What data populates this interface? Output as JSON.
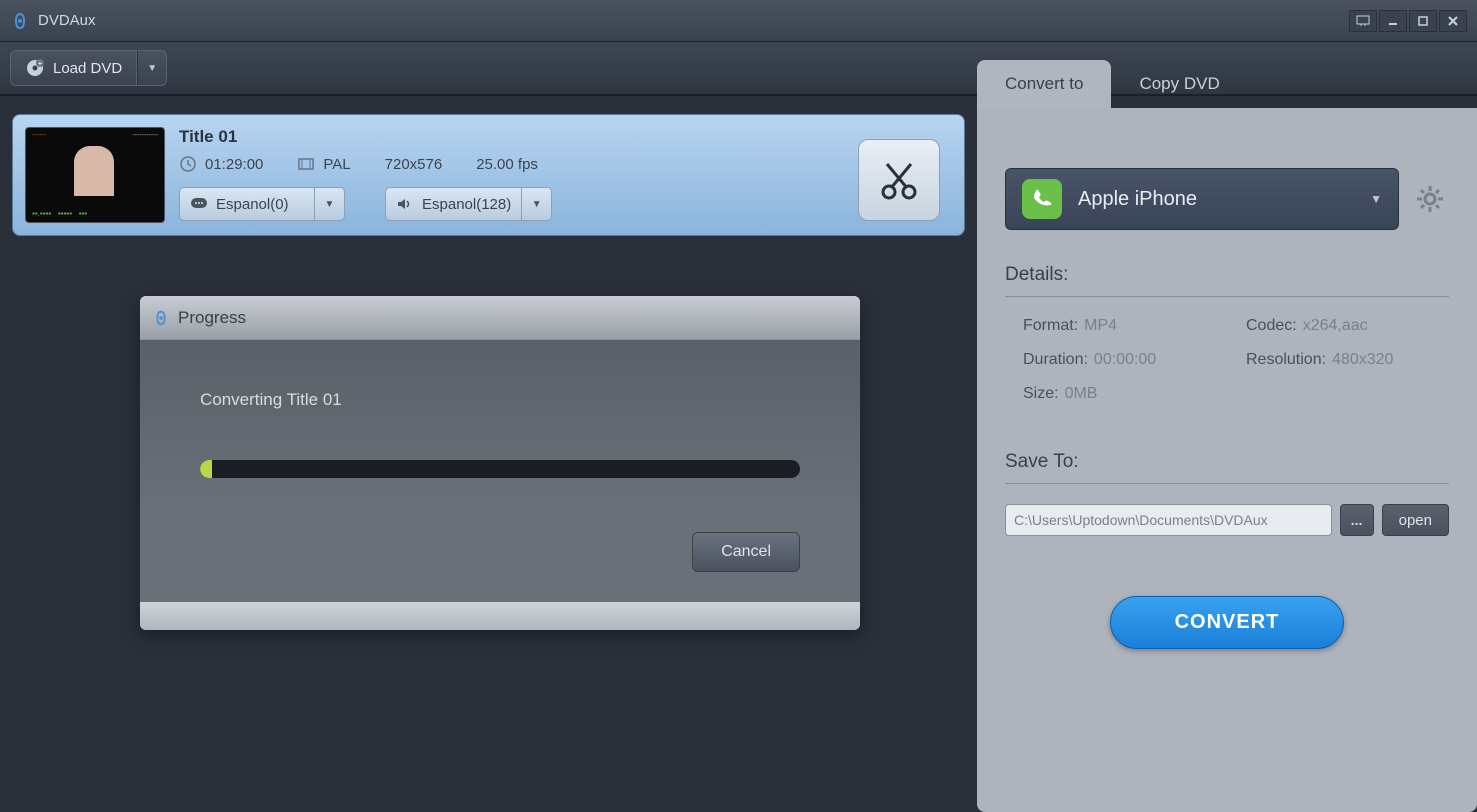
{
  "app": {
    "title": "DVDAux"
  },
  "toolbar": {
    "load_dvd": "Load DVD"
  },
  "tabs": {
    "convert": "Convert to",
    "copy": "Copy DVD"
  },
  "title_card": {
    "name": "Title 01",
    "duration": "01:29:00",
    "standard": "PAL",
    "resolution": "720x576",
    "fps": "25.00 fps",
    "subtitle": "Espanol(0)",
    "audio": "Espanol(128)"
  },
  "progress": {
    "title": "Progress",
    "status": "Converting Title 01",
    "cancel": "Cancel"
  },
  "profile": {
    "label": "Apple iPhone"
  },
  "details": {
    "heading": "Details:",
    "format_k": "Format:",
    "format_v": "MP4",
    "codec_k": "Codec:",
    "codec_v": "x264,aac",
    "duration_k": "Duration:",
    "duration_v": "00:00:00",
    "resolution_k": "Resolution:",
    "resolution_v": "480x320",
    "size_k": "Size:",
    "size_v": "0MB"
  },
  "saveto": {
    "heading": "Save To:",
    "path": "C:\\Users\\Uptodown\\Documents\\DVDAux",
    "browse": "...",
    "open": "open"
  },
  "convert": "CONVERT"
}
